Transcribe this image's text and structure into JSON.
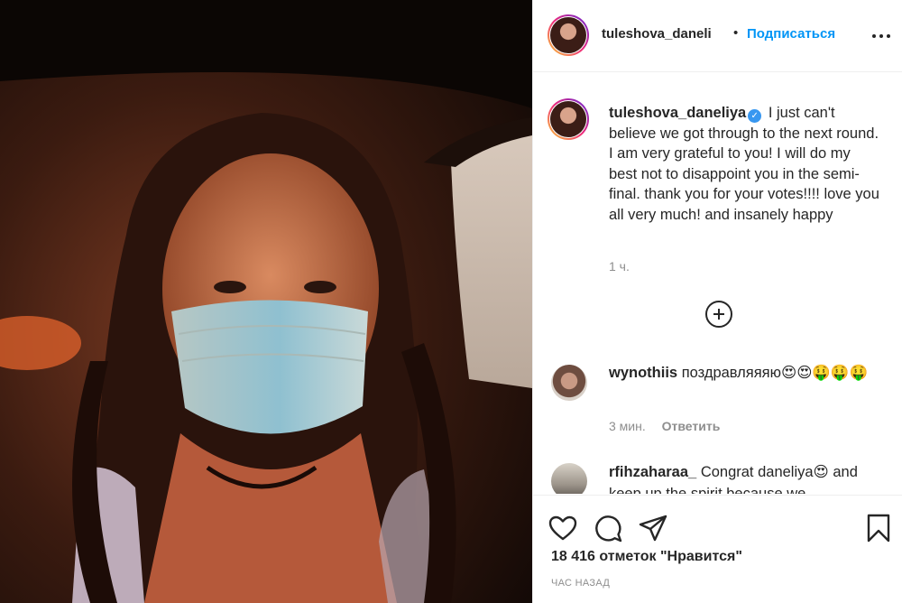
{
  "post": {
    "author": "tuleshova_daneli",
    "dot": "•",
    "follow_label": "Подписаться"
  },
  "caption": {
    "username": "tuleshova_daneliya",
    "text": "I just can't believe we got through to the next round. I am very grateful to you! I will do my best not to disappoint you in the semi-final. thank you for your votes!!!! love you all very much! and insanely happy",
    "time": "1 ч."
  },
  "comments": [
    {
      "username": "wynothiis",
      "text": "поздравляяяю😍😍🤑🤑🤑",
      "time": "3 мин.",
      "reply_label": "Ответить"
    },
    {
      "username": "rfihzaharaa_",
      "text": "Congrat daneliya😍 and keep up the spirit because we"
    }
  ],
  "footer": {
    "likes_text": "18 416 отметок \"Нравится\"",
    "posted_when": "час назад"
  },
  "icons": [
    "more-icon",
    "verified-icon",
    "add-comment-icon",
    "heart-icon",
    "comment-icon",
    "share-icon",
    "bookmark-icon"
  ],
  "colors": {
    "accent_blue": "#0095f6",
    "text": "#262626",
    "muted": "#8e8e8e"
  }
}
